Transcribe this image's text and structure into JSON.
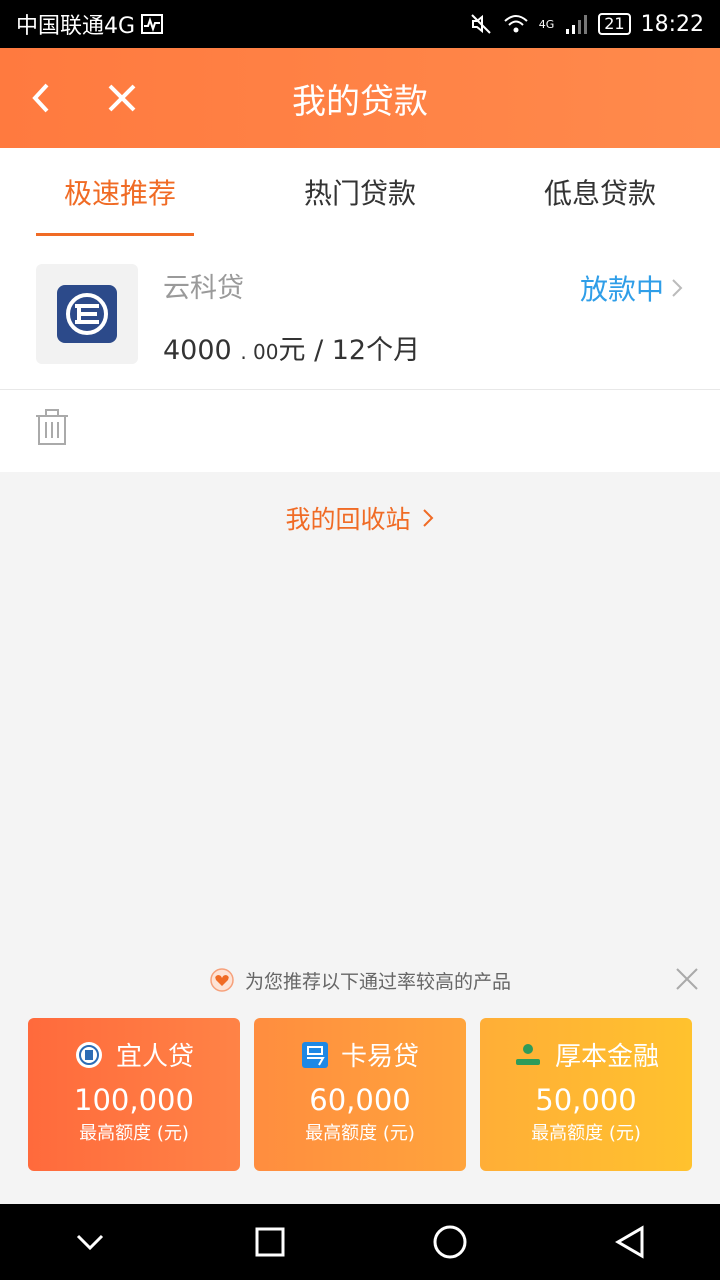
{
  "statusbar": {
    "carrier": "中国联通4G",
    "signal_label": "4G",
    "battery": "21",
    "time": "18:22"
  },
  "appbar": {
    "title": "我的贷款",
    "back_icon": "chevron-left-icon",
    "close_icon": "close-icon"
  },
  "tabs": [
    {
      "label": "极速推荐",
      "active": true
    },
    {
      "label": "热门贷款",
      "active": false
    },
    {
      "label": "低息贷款",
      "active": false
    }
  ],
  "loan": {
    "name": "云科贷",
    "amount_int": "4000",
    "amount_dec": ". 00",
    "amount_suffix": "元 / 12个月",
    "status": "放款中"
  },
  "recycle": {
    "label": "我的回收站"
  },
  "recommend": {
    "header": "为您推荐以下通过率较高的产品",
    "cards": [
      {
        "name": "宜人贷",
        "amount": "100,000",
        "label": "最高额度 (元)"
      },
      {
        "name": "卡易贷",
        "amount": "60,000",
        "label": "最高额度 (元)"
      },
      {
        "name": "厚本金融",
        "amount": "50,000",
        "label": "最高额度 (元)"
      }
    ]
  },
  "colors": {
    "accent": "#f06b25",
    "status_blue": "#2f9ee8",
    "header_orange": "#ff7a3f"
  }
}
